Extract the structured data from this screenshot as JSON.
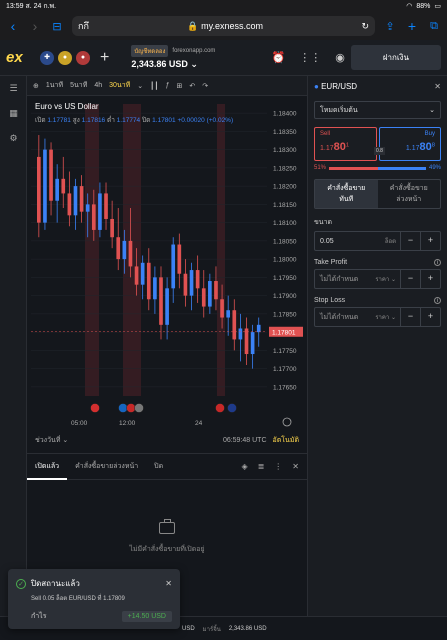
{
  "statusbar": {
    "time": "13:59",
    "date": "ส. 24 ก.พ.",
    "battery": "88%"
  },
  "browser": {
    "tab_label": "กกึ",
    "url": "my.exness.com"
  },
  "topnav": {
    "logo": "ex",
    "account_type": "บัญชีทดลอง",
    "account_server": "forexonapp.com",
    "balance": "2,343.86 USD",
    "deposit_label": "ฝากเงิน"
  },
  "toolbar": {
    "timeframes": [
      "1นาที",
      "5นาที",
      "4h",
      "30นาที"
    ],
    "active_timeframe": "30นาที"
  },
  "chart_legend": {
    "title": "Euro vs US Dollar",
    "open_label": "เปิด",
    "open": "1.17781",
    "high_label": "สูง",
    "high": "1.17816",
    "low_label": "ต่ำ",
    "low": "1.17774",
    "close_label": "ปิด",
    "close": "1.17801",
    "change": "+0.00020 (+0.02%)"
  },
  "chart_footer": {
    "range_label": "ช่วงวันที่",
    "time": "06:59:48 UTC",
    "auto": "อัตโนมัติ"
  },
  "chart_data": {
    "type": "candlestick",
    "y_ticks": [
      "1.18400",
      "1.18350",
      "1.18300",
      "1.18250",
      "1.18200",
      "1.18150",
      "1.18100",
      "1.18050",
      "1.18000",
      "1.17950",
      "1.17900",
      "1.17850",
      "1.17800",
      "1.17750",
      "1.17700",
      "1.17650"
    ],
    "x_ticks": [
      "05:00",
      "12:00",
      "24"
    ],
    "ylim": [
      1.17625,
      1.18425
    ],
    "last_price": "1.17801",
    "candles": [
      [
        1.1828,
        1.1834,
        1.1806,
        1.181
      ],
      [
        1.181,
        1.1833,
        1.1808,
        1.183
      ],
      [
        1.183,
        1.1832,
        1.1812,
        1.1816
      ],
      [
        1.1816,
        1.1826,
        1.181,
        1.1822
      ],
      [
        1.1822,
        1.1828,
        1.1814,
        1.1818
      ],
      [
        1.1818,
        1.1824,
        1.1809,
        1.1812
      ],
      [
        1.1812,
        1.1822,
        1.1808,
        1.182
      ],
      [
        1.182,
        1.1823,
        1.181,
        1.1813
      ],
      [
        1.1813,
        1.1818,
        1.1806,
        1.1815
      ],
      [
        1.1815,
        1.1819,
        1.1805,
        1.1808
      ],
      [
        1.1808,
        1.1821,
        1.1806,
        1.1818
      ],
      [
        1.1818,
        1.1821,
        1.1808,
        1.1811
      ],
      [
        1.1811,
        1.1816,
        1.1803,
        1.1806
      ],
      [
        1.1806,
        1.1814,
        1.1797,
        1.18
      ],
      [
        1.18,
        1.1808,
        1.1796,
        1.1805
      ],
      [
        1.1805,
        1.1814,
        1.1795,
        1.1798
      ],
      [
        1.1798,
        1.1803,
        1.179,
        1.1793
      ],
      [
        1.1793,
        1.1801,
        1.1789,
        1.1799
      ],
      [
        1.1799,
        1.1803,
        1.1786,
        1.1789
      ],
      [
        1.1789,
        1.1798,
        1.1785,
        1.1795
      ],
      [
        1.1795,
        1.1798,
        1.1778,
        1.1782
      ],
      [
        1.1782,
        1.1795,
        1.1778,
        1.1792
      ],
      [
        1.1792,
        1.1806,
        1.1788,
        1.1804
      ],
      [
        1.1804,
        1.1807,
        1.1792,
        1.1796
      ],
      [
        1.1796,
        1.18,
        1.1787,
        1.179
      ],
      [
        1.179,
        1.1799,
        1.1786,
        1.1797
      ],
      [
        1.1797,
        1.1801,
        1.1788,
        1.1792
      ],
      [
        1.1792,
        1.1797,
        1.1784,
        1.1787
      ],
      [
        1.1787,
        1.1796,
        1.1785,
        1.1794
      ],
      [
        1.1794,
        1.1798,
        1.1786,
        1.1789
      ],
      [
        1.1789,
        1.1793,
        1.1781,
        1.1784
      ],
      [
        1.1784,
        1.179,
        1.1779,
        1.1786
      ],
      [
        1.1786,
        1.1789,
        1.1775,
        1.1778
      ],
      [
        1.1778,
        1.1785,
        1.1772,
        1.1781
      ],
      [
        1.1781,
        1.1784,
        1.1771,
        1.1774
      ],
      [
        1.1774,
        1.1782,
        1.177,
        1.178
      ],
      [
        1.178,
        1.1784,
        1.1776,
        1.1782
      ]
    ]
  },
  "bottom_tabs": [
    "เปิดแล้ว",
    "คำสั่งซื้อขายล่วงหน้า",
    "ปิด"
  ],
  "empty_state": "ไม่มีคำสั่งซื้อขายที่เปิดอยู่",
  "order_panel": {
    "symbol": "EUR/USD",
    "mode": "โหมดเริ่มต้น",
    "sell_label": "Sell",
    "sell_price_main": "1.17",
    "sell_price_big": "80",
    "sell_price_small": "1",
    "buy_label": "Buy",
    "buy_price_main": "1.17",
    "buy_price_big": "80",
    "buy_price_small": "8",
    "spread": "0.8",
    "sell_pct": "51%",
    "buy_pct": "49%",
    "sell_fraction": 0.51,
    "order_tabs": [
      "คำสั่งซื้อขาย\nทันที",
      "คำสั่งซื้อขาย\nล่วงหน้า"
    ],
    "volume_label": "ขนาด",
    "volume": "0.05",
    "volume_unit": "ล็อต",
    "tp_label": "Take Profit",
    "tp_value": "ไม่ได้กำหนด",
    "tp_unit": "ราคา",
    "sl_label": "Stop Loss",
    "sl_value": "ไม่ได้กำหนด",
    "sl_unit": "ราคา"
  },
  "bottombar": {
    "currency": "USD",
    "margin_label": "มาร์จิ้น",
    "margin": "2,343.86 USD"
  },
  "toast": {
    "title": "ปิดสถานะแล้ว",
    "detail": "Sell 0.05 ล็อต EUR/USD ที่ 1.17809",
    "profit_label": "กำไร",
    "profit": "+14.50 USD"
  },
  "colors": {
    "bull": "#3b82f6",
    "bear": "#e05252",
    "accent": "#ffd84d"
  }
}
